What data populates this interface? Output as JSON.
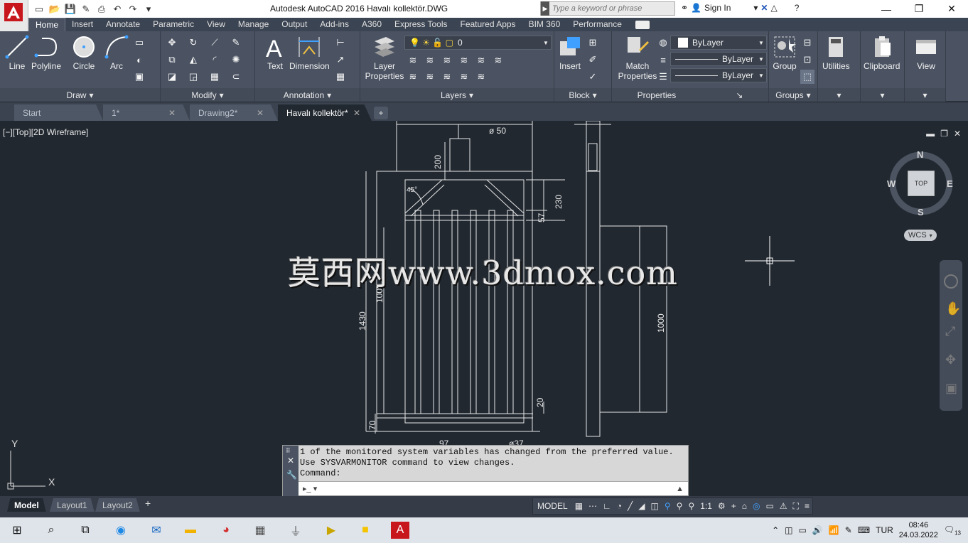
{
  "window": {
    "title": "Autodesk AutoCAD 2016    Havalı kollektör.DWG",
    "search_placeholder": "Type a keyword or phrase",
    "sign_in": "Sign In"
  },
  "ribbon_tabs": [
    "Home",
    "Insert",
    "Annotate",
    "Parametric",
    "View",
    "Manage",
    "Output",
    "Add-ins",
    "A360",
    "Express Tools",
    "Featured Apps",
    "BIM 360",
    "Performance"
  ],
  "panels": {
    "draw": {
      "title": "Draw",
      "tools": [
        "Line",
        "Polyline",
        "Circle",
        "Arc"
      ]
    },
    "modify": {
      "title": "Modify"
    },
    "annotation": {
      "title": "Annotation",
      "tools": [
        "Text",
        "Dimension"
      ]
    },
    "layers": {
      "title": "Layers",
      "tool": "Layer Properties",
      "layer_value": "0"
    },
    "block": {
      "title": "Block",
      "tool": "Insert"
    },
    "properties": {
      "title": "Properties",
      "tool": "Match Properties",
      "color": "ByLayer",
      "linetype": "ByLayer",
      "lineweight": "ByLayer"
    },
    "groups": {
      "title": "Groups",
      "tool": "Group"
    },
    "utilities": "Utilities",
    "clipboard": "Clipboard",
    "view": "View"
  },
  "doc_tabs": [
    {
      "label": "Start"
    },
    {
      "label": "1*"
    },
    {
      "label": "Drawing2*"
    },
    {
      "label": "Havalı kollektör*"
    }
  ],
  "viewport": {
    "label": "[−][Top][2D Wireframe]",
    "watermark": "莫西网www.3dmox.com",
    "compass": {
      "n": "N",
      "s": "S",
      "e": "E",
      "w": "W",
      "top": "TOP"
    },
    "wcs": "WCS",
    "ucs_x": "X",
    "ucs_y": "Y"
  },
  "dimensions": {
    "d50": "ø 50",
    "d200": "200",
    "d45": "45°",
    "d230": "230",
    "d57": "57",
    "d1000a": "1000",
    "d1430": "1430",
    "d1000b": "1000",
    "d20": "20",
    "d70": "70",
    "d97": "97",
    "d37": "ø37"
  },
  "command": {
    "line1": "1 of the monitored system variables has changed from the preferred value.",
    "line2": "Use SYSVARMONITOR command to view changes.",
    "line3": "Command:"
  },
  "layout_tabs": [
    "Model",
    "Layout1",
    "Layout2"
  ],
  "status": {
    "model": "MODEL",
    "scale": "1:1"
  },
  "taskbar": {
    "lang": "TUR",
    "time": "08:46",
    "date": "24.03.2022",
    "notif": "13"
  }
}
